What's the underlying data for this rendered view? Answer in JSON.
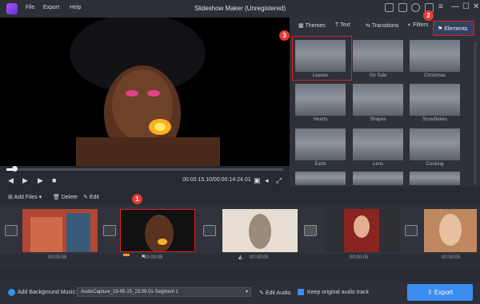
{
  "app": {
    "title": "Slideshow Maker (Unregistered)"
  },
  "menu": {
    "file": "File",
    "export": "Export",
    "help": "Help"
  },
  "player": {
    "timecode": "00:00:15.10/00:00:14:24.01",
    "progress": 0.03
  },
  "tabs": {
    "themes": "Themes",
    "text": "Text",
    "transitions": "Transitions",
    "filters": "Filters",
    "elements": "Elements"
  },
  "elements": [
    {
      "label": "Leaves",
      "selected": true
    },
    {
      "label": "On Sale"
    },
    {
      "label": "Christmas"
    },
    {
      "label": "Hearts"
    },
    {
      "label": "Shapes"
    },
    {
      "label": "Snowflakes"
    },
    {
      "label": "Earth"
    },
    {
      "label": "Lens"
    },
    {
      "label": "Cooking"
    }
  ],
  "toolbar": {
    "add_files": "Add Files",
    "delete": "Delete",
    "edit": "Edit"
  },
  "clips": [
    {
      "duration": "00:00:05"
    },
    {
      "duration": "00:00:05"
    },
    {
      "duration": "00:00:05"
    },
    {
      "duration": "00:00:05"
    },
    {
      "duration": "00:00:05"
    }
  ],
  "annotations": {
    "one": "1",
    "two": "2",
    "three": "3"
  },
  "bottom": {
    "bg_music_label": "Add Background Music:",
    "audio_file": "AudioCapture_19-05-15_23.09.01-Segment 1",
    "edit_audio": "Edit Audio",
    "keep_audio": "Keep original audio track",
    "export": "Export"
  },
  "colors": {
    "accent": "#3b8ef0",
    "highlight": "#e02020",
    "badge": "#e53935"
  }
}
